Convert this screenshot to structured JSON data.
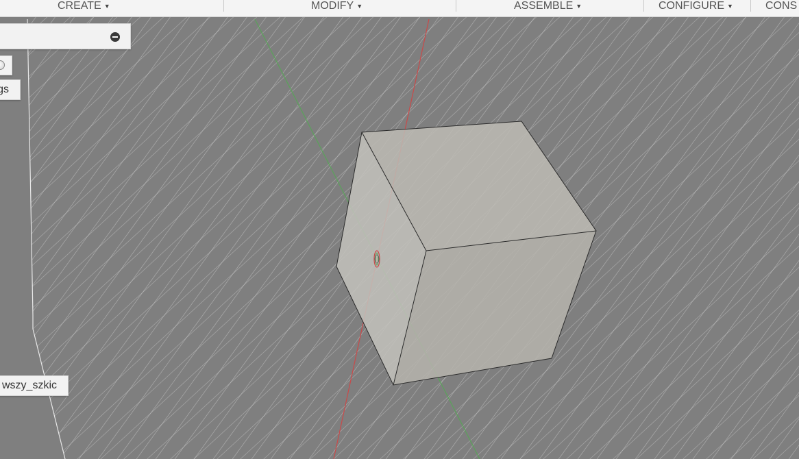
{
  "toolbar": {
    "menus": [
      {
        "label": "CREATE"
      },
      {
        "label": "MODIFY"
      },
      {
        "label": "ASSEMBLE"
      },
      {
        "label": "CONFIGURE"
      },
      {
        "label": "CONS"
      }
    ]
  },
  "browser": {
    "label_gs": "gs",
    "label_sketch": "wszy_szkic"
  },
  "colors": {
    "viewport_bg": "#7f7f7f",
    "grid_line": "#c8c8c8",
    "cube_face_top": "#bdbab3",
    "cube_face_right": "#b6b3ac",
    "cube_face_left": "#c3c1bb",
    "axis_red": "#c94a4a",
    "axis_green": "#5aa35a"
  }
}
